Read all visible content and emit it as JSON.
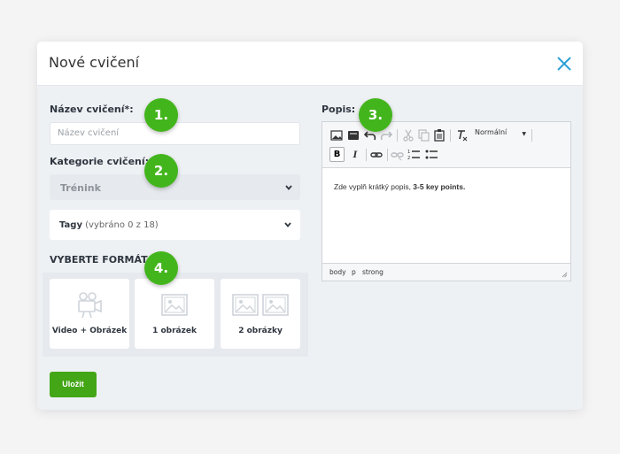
{
  "modal": {
    "title": "Nové cvičení",
    "close_icon": "close-icon"
  },
  "form": {
    "name_label": "Název cvičení*:",
    "name_placeholder": "Název cvičení",
    "category_label": "Kategorie cvičení:",
    "category_value": "Trénink",
    "tags_label": "Tagy",
    "tags_count": "(vybráno 0 z 18)",
    "format_heading": "VYBERTE FORMÁT",
    "formats": [
      {
        "label": "Video + Obrázek",
        "icon": "video-camera-icon"
      },
      {
        "label": "1 obrázek",
        "icon": "image-icon"
      },
      {
        "label": "2 obrázky",
        "icon": "two-images-icon"
      }
    ],
    "save_label": "Uložit"
  },
  "badges": [
    "1.",
    "2.",
    "3.",
    "4."
  ],
  "editor": {
    "label": "Popis:",
    "format_value": "Normální",
    "content_prefix": "Zde vyplň krátký popis, ",
    "content_bold": "3-5 key points.",
    "path": [
      "body",
      "p",
      "strong"
    ]
  },
  "colors": {
    "accent_green": "#43b51c",
    "close_blue": "#2a9fd8"
  }
}
